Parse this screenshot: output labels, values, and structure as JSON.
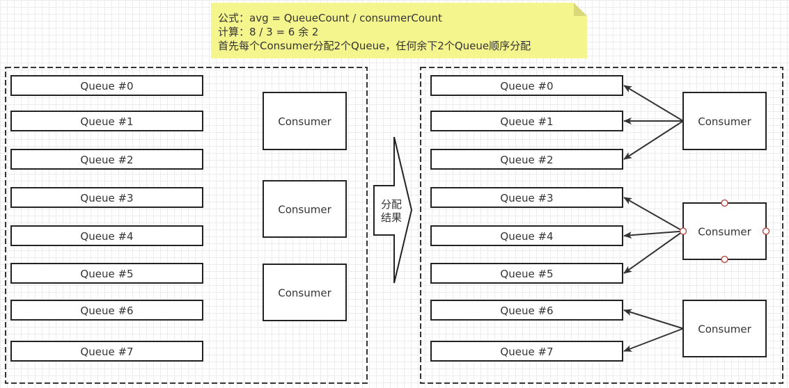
{
  "note": {
    "line1": "公式：avg = QueueCount / consumerCount",
    "line2": "计算：8 / 3 = 6 余 2",
    "line3": "首先每个Consumer分配2个Queue，任何余下2个Queue顺序分配"
  },
  "left_panel": {
    "queues": [
      "Queue #0",
      "Queue #1",
      "Queue #2",
      "Queue #3",
      "Queue #4",
      "Queue #5",
      "Queue #6",
      "Queue #7"
    ],
    "consumers": [
      "Consumer",
      "Consumer",
      "Consumer"
    ]
  },
  "arrow": {
    "line1": "分配",
    "line2": "结果"
  },
  "right_panel": {
    "queues": [
      "Queue #0",
      "Queue #1",
      "Queue #2",
      "Queue #3",
      "Queue #4",
      "Queue #5",
      "Queue #6",
      "Queue #7"
    ],
    "consumers": [
      "Consumer",
      "Consumer",
      "Consumer"
    ],
    "assignments": [
      [
        0,
        1,
        2
      ],
      [
        3,
        4,
        5
      ],
      [
        6,
        7
      ]
    ]
  },
  "colors": {
    "note_fill": "#f5f58e",
    "stroke": "#222222",
    "selection_handle": "#b85450"
  }
}
